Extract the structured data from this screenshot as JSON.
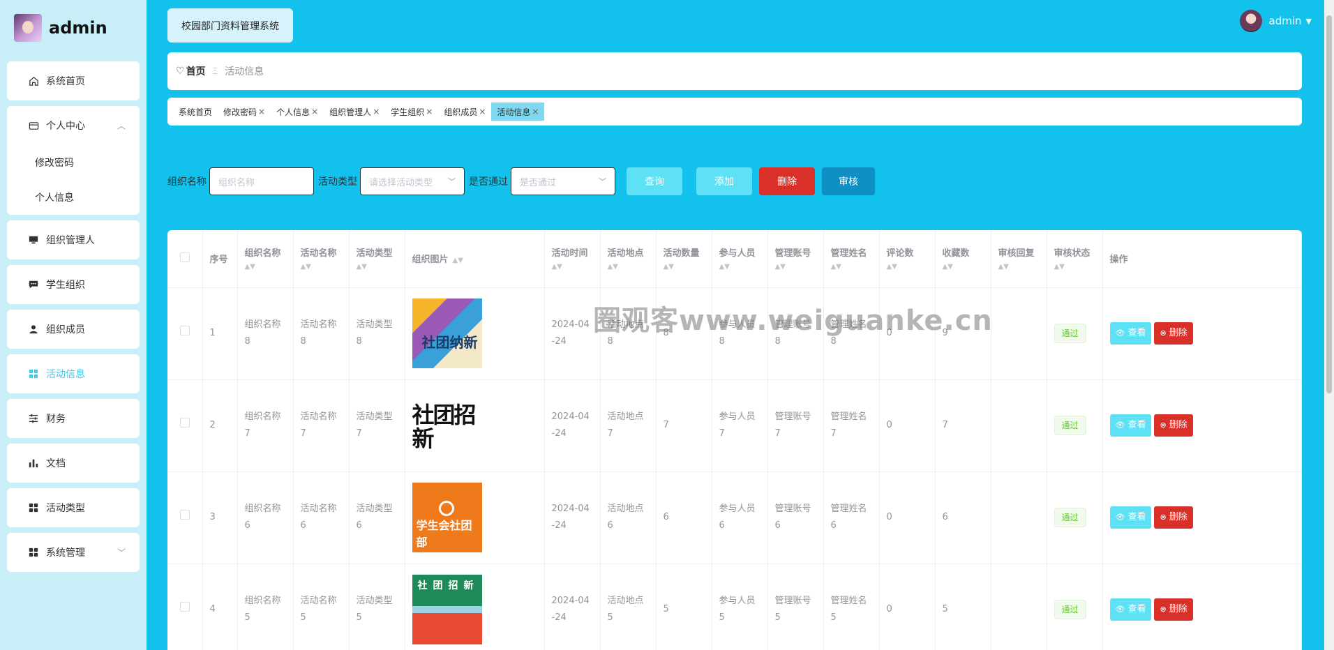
{
  "brand": {
    "name": "admin"
  },
  "sidebar": {
    "items": [
      {
        "label": "系统首页",
        "icon": "home-icon"
      },
      {
        "label": "个人中心",
        "icon": "card-icon",
        "expanded": true,
        "children": [
          "修改密码",
          "个人信息"
        ]
      },
      {
        "label": "组织管理人",
        "icon": "monitor-icon"
      },
      {
        "label": "学生组织",
        "icon": "chat-icon"
      },
      {
        "label": "组织成员",
        "icon": "user-icon"
      },
      {
        "label": "活动信息",
        "icon": "grid-icon",
        "active": true
      },
      {
        "label": "财务",
        "icon": "sliders-icon"
      },
      {
        "label": "文档",
        "icon": "bar-chart-icon"
      },
      {
        "label": "活动类型",
        "icon": "grid-icon"
      },
      {
        "label": "系统管理",
        "icon": "grid-icon",
        "expandable": true
      }
    ]
  },
  "header": {
    "system_title": "校园部门资料管理系统",
    "user": "admin"
  },
  "breadcrumb": {
    "home": "首页",
    "separator": "Ξ",
    "current": "活动信息"
  },
  "tags": [
    {
      "label": "系统首页",
      "closable": false
    },
    {
      "label": "修改密码",
      "closable": true
    },
    {
      "label": "个人信息",
      "closable": true
    },
    {
      "label": "组织管理人",
      "closable": true
    },
    {
      "label": "学生组织",
      "closable": true
    },
    {
      "label": "组织成员",
      "closable": true
    },
    {
      "label": "活动信息",
      "closable": true,
      "active": true
    }
  ],
  "search": {
    "org_name_label": "组织名称",
    "org_name_placeholder": "组织名称",
    "type_label": "活动类型",
    "type_placeholder": "请选择活动类型",
    "passed_label": "是否通过",
    "passed_placeholder": "是否通过",
    "query_btn": "查询",
    "add_btn": "添加",
    "delete_btn": "删除",
    "audit_btn": "审核"
  },
  "table": {
    "headers": [
      "序号",
      "组织名称",
      "活动名称",
      "活动类型",
      "组织图片",
      "活动时间",
      "活动地点",
      "活动数量",
      "参与人员",
      "管理账号",
      "管理姓名",
      "评论数",
      "收藏数",
      "审核回复",
      "审核状态",
      "操作"
    ],
    "rows": [
      {
        "index": "1",
        "org": [
          "组织名称",
          "8"
        ],
        "act": [
          "活动名称",
          "8"
        ],
        "type": [
          "活动类型",
          "8"
        ],
        "img_caption": "社团纳新",
        "time": [
          "2024-04",
          "-24"
        ],
        "place": [
          "活动地点",
          "8"
        ],
        "count": "8",
        "people": [
          "参与人员",
          "8"
        ],
        "account": [
          "管理账号",
          "8"
        ],
        "manager": [
          "管理姓名",
          "8"
        ],
        "comments": "0",
        "favorites": "9",
        "reply": "",
        "status": "通过"
      },
      {
        "index": "2",
        "org": [
          "组织名称",
          "7"
        ],
        "act": [
          "活动名称",
          "7"
        ],
        "type": [
          "活动类型",
          "7"
        ],
        "img_caption": "社团招新",
        "time": [
          "2024-04",
          "-24"
        ],
        "place": [
          "活动地点",
          "7"
        ],
        "count": "7",
        "people": [
          "参与人员",
          "7"
        ],
        "account": [
          "管理账号",
          "7"
        ],
        "manager": [
          "管理姓名",
          "7"
        ],
        "comments": "0",
        "favorites": "7",
        "reply": "",
        "status": "通过"
      },
      {
        "index": "3",
        "org": [
          "组织名称",
          "6"
        ],
        "act": [
          "活动名称",
          "6"
        ],
        "type": [
          "活动类型",
          "6"
        ],
        "img_caption": "学生会社团部",
        "time": [
          "2024-04",
          "-24"
        ],
        "place": [
          "活动地点",
          "6"
        ],
        "count": "6",
        "people": [
          "参与人员",
          "6"
        ],
        "account": [
          "管理账号",
          "6"
        ],
        "manager": [
          "管理姓名",
          "6"
        ],
        "comments": "0",
        "favorites": "6",
        "reply": "",
        "status": "通过"
      },
      {
        "index": "4",
        "org": [
          "组织名称",
          "5"
        ],
        "act": [
          "活动名称",
          "5"
        ],
        "type": [
          "活动类型",
          "5"
        ],
        "img_caption": "社团招新",
        "time": [
          "2024-04",
          "-24"
        ],
        "place": [
          "活动地点",
          "5"
        ],
        "count": "5",
        "people": [
          "参与人员",
          "5"
        ],
        "account": [
          "管理账号",
          "5"
        ],
        "manager": [
          "管理姓名",
          "5"
        ],
        "comments": "0",
        "favorites": "5",
        "reply": "",
        "status": "通过"
      }
    ],
    "view_btn": "查看",
    "delete_btn": "删除"
  },
  "watermark": "圈观客www.weiguanke.cn",
  "colors": {
    "accent": "#13c2ec",
    "danger": "#d9302a",
    "success": "#67c23a"
  }
}
